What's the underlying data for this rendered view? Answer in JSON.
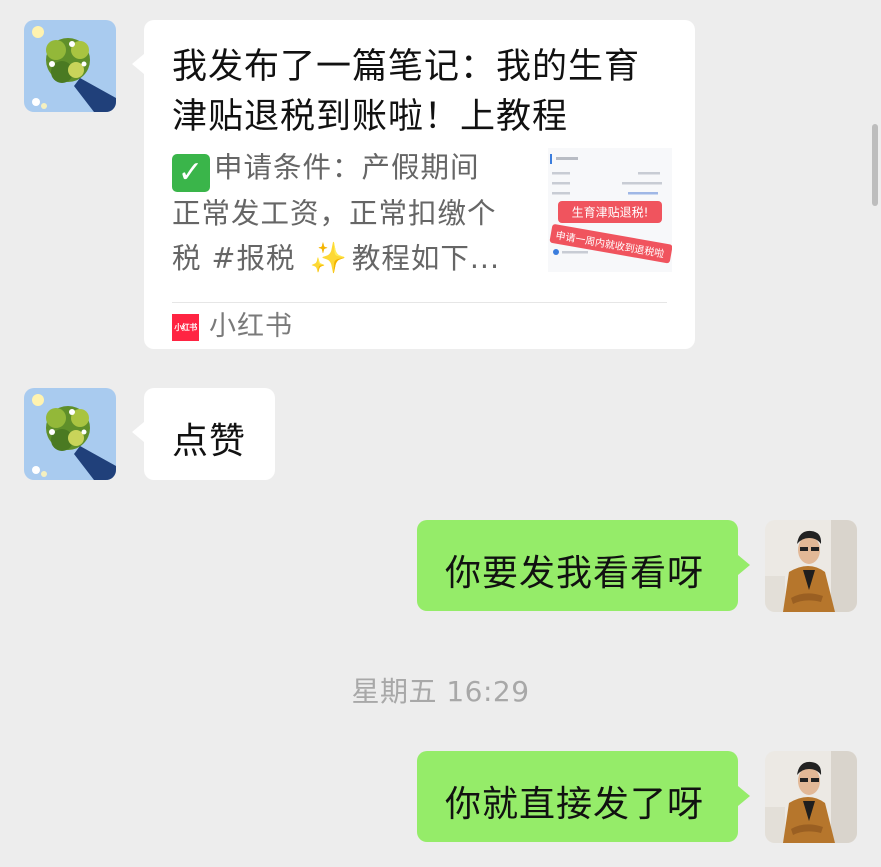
{
  "messages": [
    {
      "type": "link-card",
      "sender": "contact",
      "card": {
        "title": "我发布了一篇笔记：我的生育津贴退税到账啦！上教程",
        "description_icon": "check-mark-icon",
        "description_line1": "申请条件：产假期间",
        "description_line2": "正常发工资，正常扣缴个",
        "description_line3_a": "税 #报税 ",
        "description_line3_icon": "sparkles-icon",
        "description_line3_b": "教程如下...",
        "thumbnail_banner_1": "生育津贴退税!",
        "thumbnail_banner_2": "申请一周内就收到退税啦",
        "source_logo_text": "小红书",
        "source_name": "小红书"
      }
    },
    {
      "type": "text",
      "sender": "contact",
      "text": "点赞"
    },
    {
      "type": "text",
      "sender": "me",
      "text": "你要发我看看呀"
    },
    {
      "type": "timestamp",
      "text": "星期五 16:29"
    },
    {
      "type": "text",
      "sender": "me",
      "text": "你就直接发了呀"
    }
  ],
  "colors": {
    "background": "#ededed",
    "incoming_bubble": "#ffffff",
    "outgoing_bubble": "#95ec69",
    "timestamp_text": "#a8a8a8",
    "brand_red": "#ff2442"
  }
}
